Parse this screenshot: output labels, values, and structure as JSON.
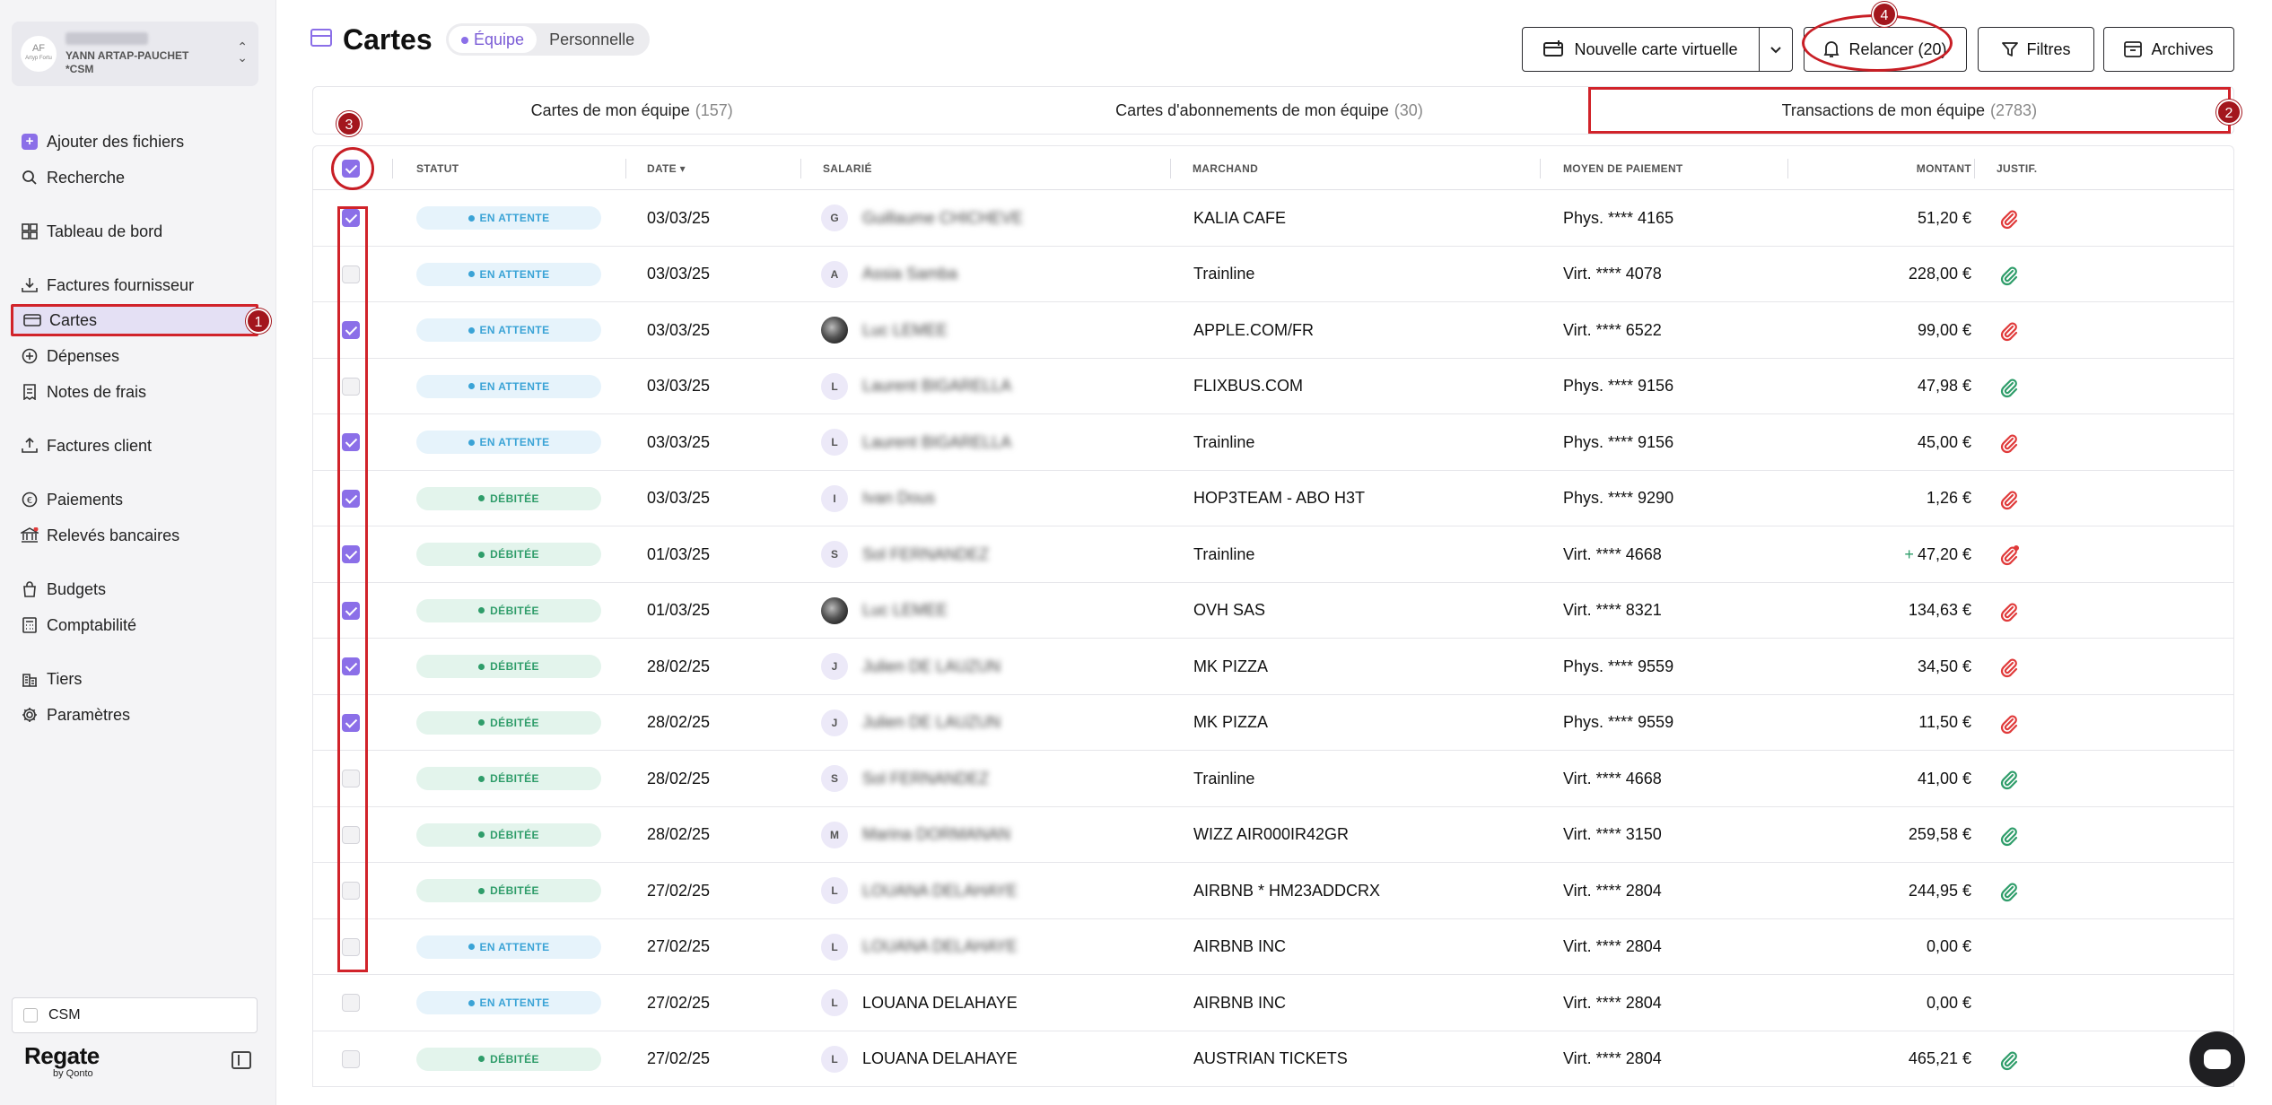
{
  "sidebar": {
    "org_logo": "AF",
    "org_logo_sub": "Artyp Fortu",
    "org_user": "YANN ARTAP-PAUCHET",
    "org_role": "*CSM",
    "items": [
      {
        "label": "Ajouter des fichiers",
        "icon": "plus-square-icon"
      },
      {
        "label": "Recherche",
        "icon": "search-icon"
      },
      {
        "label": "Tableau de bord",
        "icon": "dashboard-icon"
      },
      {
        "label": "Factures fournisseur",
        "icon": "download-icon"
      },
      {
        "label": "Cartes",
        "icon": "card-icon"
      },
      {
        "label": "Dépenses",
        "icon": "plus-circle-icon"
      },
      {
        "label": "Notes de frais",
        "icon": "receipt-icon"
      },
      {
        "label": "Factures client",
        "icon": "upload-icon"
      },
      {
        "label": "Paiements",
        "icon": "euro-icon"
      },
      {
        "label": "Relevés bancaires",
        "icon": "bank-icon"
      },
      {
        "label": "Budgets",
        "icon": "bag-icon"
      },
      {
        "label": "Comptabilité",
        "icon": "calculator-icon"
      },
      {
        "label": "Tiers",
        "icon": "building-icon"
      },
      {
        "label": "Paramètres",
        "icon": "gear-icon"
      }
    ],
    "csm_checkbox_label": "CSM",
    "brand": "Regate",
    "brand_sub": "by Qonto"
  },
  "annotations": {
    "n1": "1",
    "n2": "2",
    "n3": "3",
    "n4": "4"
  },
  "header": {
    "title": "Cartes",
    "segment_team": "Équipe",
    "segment_personal": "Personnelle",
    "new_card_label": "Nouvelle carte virtuelle",
    "relancer_label": "Relancer (20)",
    "filters_label": "Filtres",
    "archives_label": "Archives"
  },
  "tabs": [
    {
      "label": "Cartes de mon équipe",
      "count": "(157)"
    },
    {
      "label": "Cartes d'abonnements de mon équipe",
      "count": "(30)"
    },
    {
      "label": "Transactions de mon équipe",
      "count": "(2783)"
    }
  ],
  "table": {
    "columns": {
      "status": "STATUT",
      "date": "DATE",
      "employee": "SALARIÉ",
      "merchant": "MARCHAND",
      "payment": "MOYEN DE PAIEMENT",
      "amount": "MONTANT",
      "proof": "JUSTIF."
    },
    "rows": [
      {
        "checked": true,
        "status": "EN ATTENTE",
        "kind": "wait",
        "date": "03/03/25",
        "initial": "G",
        "photo": false,
        "employee": "Guillaume CHICHEVE",
        "blurred": true,
        "merchant": "KALIA CAFE",
        "payment": "Phys. **** 4165",
        "amount": "51,20 €",
        "plus": false,
        "proof": "missing"
      },
      {
        "checked": false,
        "status": "EN ATTENTE",
        "kind": "wait",
        "date": "03/03/25",
        "initial": "A",
        "photo": false,
        "employee": "Assia Samba",
        "blurred": true,
        "merchant": "Trainline",
        "payment": "Virt. **** 4078",
        "amount": "228,00 €",
        "plus": false,
        "proof": "ok"
      },
      {
        "checked": true,
        "status": "EN ATTENTE",
        "kind": "wait",
        "date": "03/03/25",
        "initial": "",
        "photo": true,
        "employee": "Luc LEMEE",
        "blurred": true,
        "merchant": "APPLE.COM/FR",
        "payment": "Virt. **** 6522",
        "amount": "99,00 €",
        "plus": false,
        "proof": "missing"
      },
      {
        "checked": false,
        "status": "EN ATTENTE",
        "kind": "wait",
        "date": "03/03/25",
        "initial": "L",
        "photo": false,
        "employee": "Laurent BIGARELLA",
        "blurred": true,
        "merchant": "FLIXBUS.COM",
        "payment": "Phys. **** 9156",
        "amount": "47,98 €",
        "plus": false,
        "proof": "ok"
      },
      {
        "checked": true,
        "status": "EN ATTENTE",
        "kind": "wait",
        "date": "03/03/25",
        "initial": "L",
        "photo": false,
        "employee": "Laurent BIGARELLA",
        "blurred": true,
        "merchant": "Trainline",
        "payment": "Phys. **** 9156",
        "amount": "45,00 €",
        "plus": false,
        "proof": "missing"
      },
      {
        "checked": true,
        "status": "DÉBITÉE",
        "kind": "debit",
        "date": "03/03/25",
        "initial": "I",
        "photo": false,
        "employee": "Ivan Dous",
        "blurred": true,
        "merchant": "HOP3TEAM - ABO H3T",
        "payment": "Phys. **** 9290",
        "amount": "1,26 €",
        "plus": false,
        "proof": "missing"
      },
      {
        "checked": true,
        "status": "DÉBITÉE",
        "kind": "debit",
        "date": "01/03/25",
        "initial": "S",
        "photo": false,
        "employee": "Sol FERNANDEZ",
        "blurred": true,
        "merchant": "Trainline",
        "payment": "Virt. **** 4668",
        "amount": "47,20 €",
        "plus": true,
        "proof": "alert"
      },
      {
        "checked": true,
        "status": "DÉBITÉE",
        "kind": "debit",
        "date": "01/03/25",
        "initial": "",
        "photo": true,
        "employee": "Luc LEMEE",
        "blurred": true,
        "merchant": "OVH SAS",
        "payment": "Virt. **** 8321",
        "amount": "134,63 €",
        "plus": false,
        "proof": "missing"
      },
      {
        "checked": true,
        "status": "DÉBITÉE",
        "kind": "debit",
        "date": "28/02/25",
        "initial": "J",
        "photo": false,
        "employee": "Julien DE LAUZUN",
        "blurred": true,
        "merchant": "MK PIZZA",
        "payment": "Phys. **** 9559",
        "amount": "34,50 €",
        "plus": false,
        "proof": "missing"
      },
      {
        "checked": true,
        "status": "DÉBITÉE",
        "kind": "debit",
        "date": "28/02/25",
        "initial": "J",
        "photo": false,
        "employee": "Julien DE LAUZUN",
        "blurred": true,
        "merchant": "MK PIZZA",
        "payment": "Phys. **** 9559",
        "amount": "11,50 €",
        "plus": false,
        "proof": "missing"
      },
      {
        "checked": false,
        "status": "DÉBITÉE",
        "kind": "debit",
        "date": "28/02/25",
        "initial": "S",
        "photo": false,
        "employee": "Sol FERNANDEZ",
        "blurred": true,
        "merchant": "Trainline",
        "payment": "Virt. **** 4668",
        "amount": "41,00 €",
        "plus": false,
        "proof": "ok"
      },
      {
        "checked": false,
        "status": "DÉBITÉE",
        "kind": "debit",
        "date": "28/02/25",
        "initial": "M",
        "photo": false,
        "employee": "Marina DORMANAN",
        "blurred": true,
        "merchant": "WIZZ AIR000IR42GR",
        "payment": "Virt. **** 3150",
        "amount": "259,58 €",
        "plus": false,
        "proof": "ok"
      },
      {
        "checked": false,
        "status": "DÉBITÉE",
        "kind": "debit",
        "date": "27/02/25",
        "initial": "L",
        "photo": false,
        "employee": "LOUANA DELAHAYE",
        "blurred": true,
        "merchant": "AIRBNB * HM23ADDCRX",
        "payment": "Virt. **** 2804",
        "amount": "244,95 €",
        "plus": false,
        "proof": "ok"
      },
      {
        "checked": false,
        "status": "EN ATTENTE",
        "kind": "wait",
        "date": "27/02/25",
        "initial": "L",
        "photo": false,
        "employee": "LOUANA DELAHAYE",
        "blurred": true,
        "merchant": "AIRBNB INC",
        "payment": "Virt. **** 2804",
        "amount": "0,00 €",
        "plus": false,
        "proof": "none"
      },
      {
        "checked": false,
        "status": "EN ATTENTE",
        "kind": "wait",
        "date": "27/02/25",
        "initial": "L",
        "photo": false,
        "employee": "LOUANA DELAHAYE",
        "blurred": false,
        "merchant": "AIRBNB INC",
        "payment": "Virt. **** 2804",
        "amount": "0,00 €",
        "plus": false,
        "proof": "none"
      },
      {
        "checked": false,
        "status": "DÉBITÉE",
        "kind": "debit",
        "date": "27/02/25",
        "initial": "L",
        "photo": false,
        "employee": "LOUANA DELAHAYE",
        "blurred": false,
        "merchant": "AUSTRIAN TICKETS",
        "payment": "Virt. **** 2804",
        "amount": "465,21 €",
        "plus": false,
        "proof": "ok"
      }
    ]
  },
  "colors": {
    "accent": "#8b6fe8",
    "annotation_red": "#d1232a",
    "proof_missing": "#e03a3a",
    "proof_ok": "#2f9d6a"
  }
}
